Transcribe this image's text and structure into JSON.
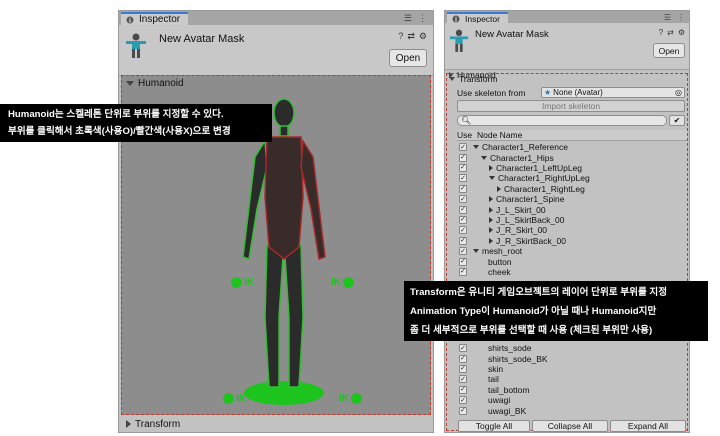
{
  "left_panel": {
    "tab_label": "Inspector",
    "asset_name": "New Avatar Mask",
    "open_label": "Open",
    "humanoid_label": "Humanoid",
    "transform_label": "Transform",
    "ik_label": "IK"
  },
  "right_panel": {
    "tab_label": "Inspector",
    "asset_name": "New Avatar Mask",
    "open_label": "Open",
    "humanoid_label": "Humanoid",
    "transform_label": "Transform",
    "skeleton_label": "Use skeleton from",
    "skeleton_value": "None (Avatar)",
    "import_label": "Import skeleton",
    "col_use": "Use",
    "col_node": "Node Name",
    "tree_top": [
      {
        "label": "Character1_Reference",
        "indent": 0,
        "fold": "d"
      },
      {
        "label": "Character1_Hips",
        "indent": 1,
        "fold": "d"
      },
      {
        "label": "Character1_LeftUpLeg",
        "indent": 2,
        "fold": "r"
      },
      {
        "label": "Character1_RightUpLeg",
        "indent": 2,
        "fold": "d"
      },
      {
        "label": "Character1_RightLeg",
        "indent": 3,
        "fold": "r"
      },
      {
        "label": "Character1_Spine",
        "indent": 2,
        "fold": "r"
      },
      {
        "label": "J_L_Skirt_00",
        "indent": 2,
        "fold": "r"
      },
      {
        "label": "J_L_SkirtBack_00",
        "indent": 2,
        "fold": "r"
      },
      {
        "label": "J_R_Skirt_00",
        "indent": 2,
        "fold": "r"
      },
      {
        "label": "J_R_SkirtBack_00",
        "indent": 2,
        "fold": "r"
      },
      {
        "label": "mesh_root",
        "indent": 0,
        "fold": "d"
      },
      {
        "label": "button",
        "indent": 1,
        "fold": ""
      },
      {
        "label": "cheek",
        "indent": 1,
        "fold": ""
      }
    ],
    "tree_bottom": [
      {
        "label": "shirts_sode",
        "indent": 1,
        "fold": ""
      },
      {
        "label": "shirts_sode_BK",
        "indent": 1,
        "fold": ""
      },
      {
        "label": "skin",
        "indent": 1,
        "fold": ""
      },
      {
        "label": "tail",
        "indent": 1,
        "fold": ""
      },
      {
        "label": "tail_bottom",
        "indent": 1,
        "fold": ""
      },
      {
        "label": "uwagi",
        "indent": 1,
        "fold": ""
      },
      {
        "label": "uwagi_BK",
        "indent": 1,
        "fold": ""
      }
    ],
    "toggle_all": "Toggle All",
    "collapse_all": "Collapse All",
    "expand_all": "Expand All"
  },
  "annotations": {
    "humanoid_line1": "Humanoid는 스켈레톤 단위로 부위를 지정할 수 있다.",
    "humanoid_line2": "부위를 클릭해서 초록색(사용O)/빨간색(사용X)으로 변경",
    "transform_line1": "Transform은 유니티 게임오브젝트의 레이어 단위로 부위를 지정",
    "transform_line2": "Animation Type이 Humanoid가 아닐 때나 Humanoid지만",
    "transform_line3": "좀 더 세부적으로 부위를 선택할 때 사용 (체크된 부위만 사용)"
  },
  "colors": {
    "active_part": "#2fbf2f",
    "inactive_part": "#a52a2a",
    "dashed_border": "#c0392b",
    "tab_accent": "#3a79d6"
  }
}
